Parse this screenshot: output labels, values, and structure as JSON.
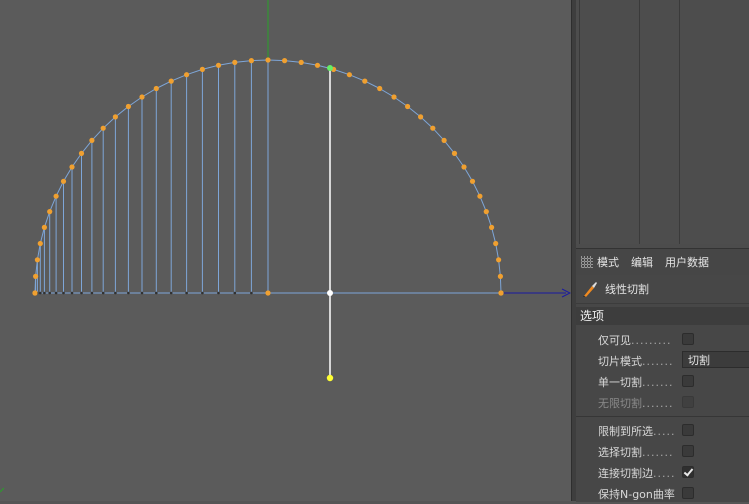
{
  "attributes": {
    "menu": [
      {
        "label": "模式"
      },
      {
        "label": "编辑"
      },
      {
        "label": "用户数据"
      }
    ],
    "tool_name": "线性切割",
    "section_title": "选项",
    "options": [
      {
        "label": "仅可见",
        "dots": ".........",
        "control": "checkbox",
        "checked": false,
        "disabled": false
      },
      {
        "label": "切片模式",
        "dots": ".......",
        "control": "dropdown",
        "value": "切割",
        "disabled": false
      },
      {
        "label": "单一切割",
        "dots": ".......",
        "control": "checkbox",
        "checked": false,
        "disabled": false
      },
      {
        "label": "无限切割",
        "dots": ".......",
        "control": "checkbox",
        "checked": false,
        "disabled": true
      },
      {
        "label": "限制到所选",
        "dots": ".....",
        "control": "checkbox",
        "checked": false,
        "disabled": false
      },
      {
        "label": "选择切割",
        "dots": ".......",
        "control": "checkbox",
        "checked": false,
        "disabled": false
      },
      {
        "label": "连接切割边",
        "dots": ".....",
        "control": "checkbox",
        "checked": true,
        "disabled": false
      },
      {
        "label": "保持N-gon曲率",
        "dots": "",
        "control": "checkbox",
        "checked": false,
        "disabled": false
      }
    ]
  },
  "viewport": {
    "background": "#5b5b5b",
    "edge_color": "#7ea6d8",
    "point_color": "#f0a030",
    "selected_point_color": "#66ee66",
    "cut_handle_color": "#ffff33",
    "cut_line_color": "#ffffff",
    "x_axis_color": "#1a1aa0",
    "y_axis_color": "#2aa02a"
  }
}
